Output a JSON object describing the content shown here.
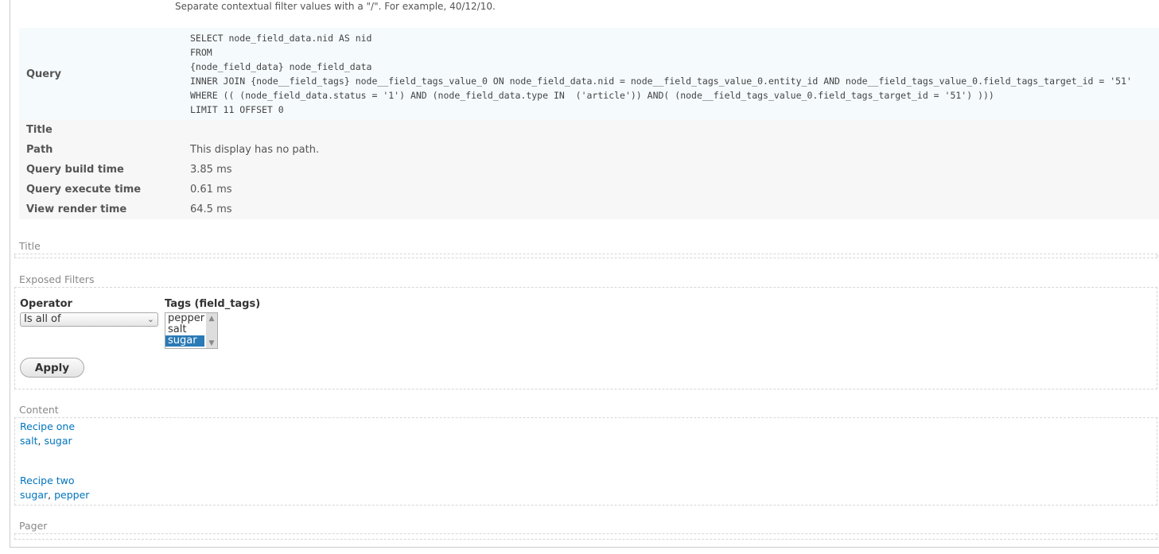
{
  "hint": "Separate contextual filter values with a \"/\". For example, 40/12/10.",
  "preview": {
    "query_label": "Query",
    "query_lines": [
      "SELECT node_field_data.nid AS nid",
      "FROM",
      "{node_field_data} node_field_data",
      "INNER JOIN {node__field_tags} node__field_tags_value_0 ON node_field_data.nid = node__field_tags_value_0.entity_id AND node__field_tags_value_0.field_tags_target_id = '51'",
      "WHERE (( (node_field_data.status = '1') AND (node_field_data.type IN  ('article')) AND( (node__field_tags_value_0.field_tags_target_id = '51') )))",
      "LIMIT 11 OFFSET 0"
    ],
    "rows": [
      {
        "label": "Title",
        "value": ""
      },
      {
        "label": "Path",
        "value": "This display has no path."
      },
      {
        "label": "Query build time",
        "value": "3.85 ms"
      },
      {
        "label": "Query execute time",
        "value": "0.61 ms"
      },
      {
        "label": "View render time",
        "value": "64.5 ms"
      }
    ]
  },
  "sections": {
    "title": "Title",
    "exposed_filters": "Exposed Filters",
    "content": "Content",
    "pager": "Pager"
  },
  "filters": {
    "operator_label": "Operator",
    "operator_value": "Is all of",
    "tags_label": "Tags (field_tags)",
    "tags_options": [
      "pepper",
      "salt",
      "sugar"
    ],
    "tags_selected": "sugar",
    "apply_label": "Apply"
  },
  "content": [
    {
      "title": "Recipe one",
      "tags": [
        "salt",
        "sugar"
      ]
    },
    {
      "title": "Recipe two",
      "tags": [
        "sugar",
        "pepper"
      ]
    }
  ],
  "colors": {
    "link": "#0074bd",
    "selected": "#2a7ab5"
  }
}
